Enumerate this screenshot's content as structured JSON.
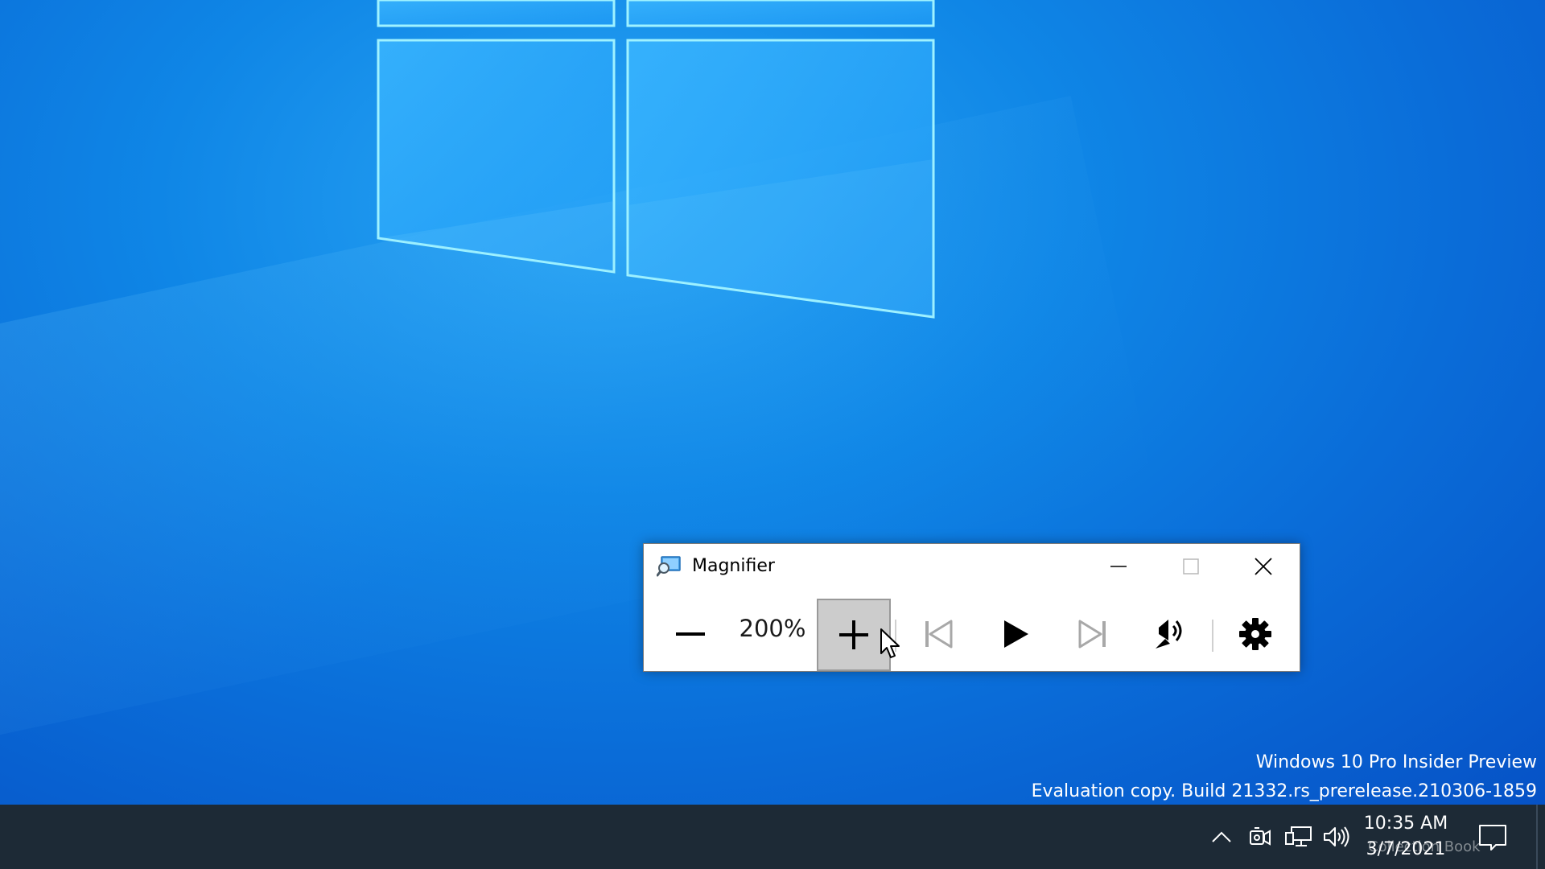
{
  "colors": {
    "desktop_accent": "#0f86e6",
    "taskbar": "#1d2a36",
    "pressed_button": "#cccccc"
  },
  "desktop": {
    "watermark_line1": "Windows 10 Pro Insider Preview",
    "watermark_line2": "Evaluation copy. Build 21332.rs_prerelease.210306-1859"
  },
  "magnifier": {
    "title": "Magnifier",
    "app_icon": "magnifier-icon",
    "zoom_level": "200%",
    "buttons": {
      "zoom_out": "minus-icon",
      "zoom_in": "plus-icon",
      "previous": "skip-previous-icon",
      "play": "play-icon",
      "next": "skip-next-icon",
      "read_from_here": "read-from-here-icon",
      "settings": "gear-icon"
    },
    "window_controls": [
      "minimize-icon",
      "maximize-icon",
      "close-icon"
    ]
  },
  "taskbar": {
    "tray_icons": [
      "chevron-up-icon",
      "camera-in-use-icon",
      "network-icon",
      "volume-icon"
    ],
    "time": "10:35 AM",
    "date": "3/7/2021",
    "overlay_text": "Collection Book",
    "action_center": "notifications-icon"
  }
}
